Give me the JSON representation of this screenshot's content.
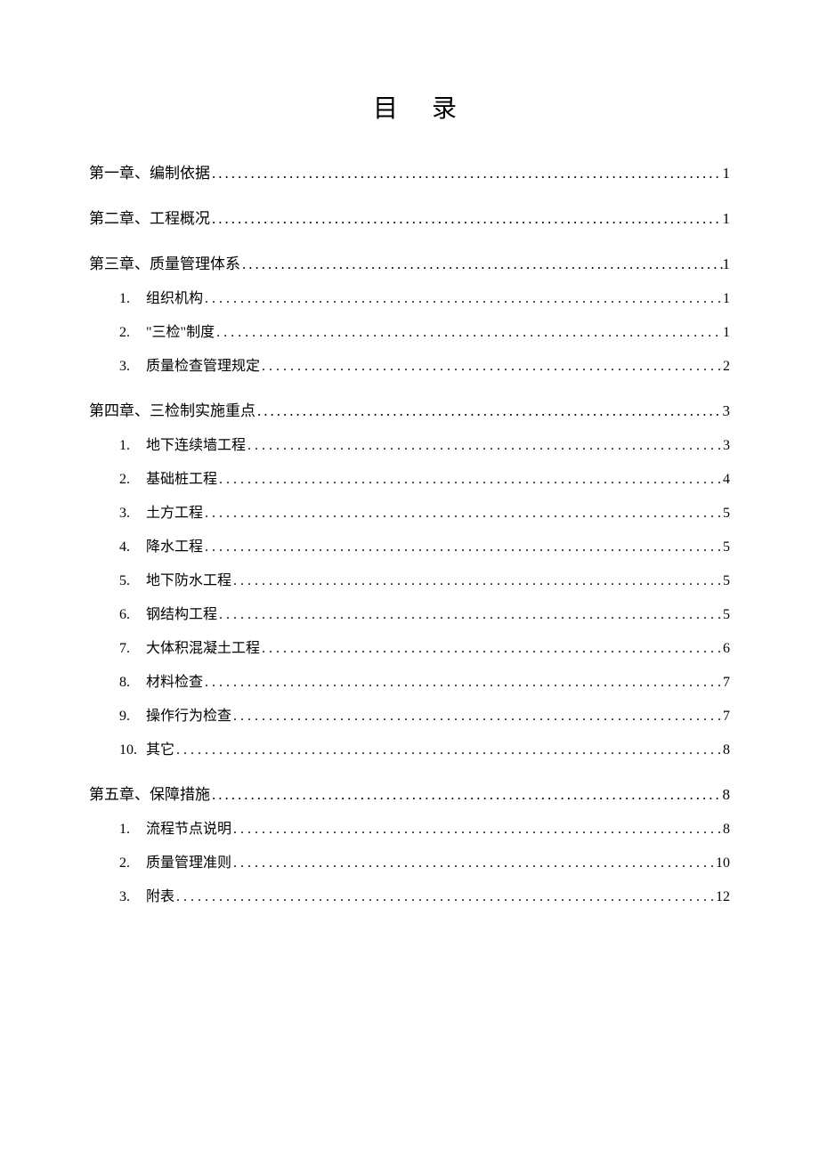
{
  "title": "目录",
  "toc": {
    "chapters": [
      {
        "label": "第一章、编制依据",
        "page": "1",
        "subs": []
      },
      {
        "label": "第二章、工程概况",
        "page": "1",
        "subs": []
      },
      {
        "label": "第三章、质量管理体系",
        "page": "1",
        "subs": [
          {
            "num": "1.",
            "label": "组织机构",
            "page": "1"
          },
          {
            "num": "2.",
            "label": "\"三检\"制度",
            "page": "1"
          },
          {
            "num": "3.",
            "label": "质量检查管理规定",
            "page": "2"
          }
        ]
      },
      {
        "label": "第四章、三检制实施重点",
        "page": "3",
        "subs": [
          {
            "num": "1.",
            "label": "地下连续墙工程",
            "page": "3"
          },
          {
            "num": "2.",
            "label": "基础桩工程",
            "page": "4"
          },
          {
            "num": "3.",
            "label": "土方工程",
            "page": "5"
          },
          {
            "num": "4.",
            "label": "降水工程",
            "page": "5"
          },
          {
            "num": "5.",
            "label": "地下防水工程",
            "page": "5"
          },
          {
            "num": "6.",
            "label": "钢结构工程",
            "page": "5"
          },
          {
            "num": "7.",
            "label": "大体积混凝土工程",
            "page": "6"
          },
          {
            "num": "8.",
            "label": "材料检查",
            "page": "7"
          },
          {
            "num": "9.",
            "label": "操作行为检查",
            "page": "7"
          },
          {
            "num": "10.",
            "label": "其它",
            "page": "8"
          }
        ]
      },
      {
        "label": "第五章、保障措施",
        "page": "8",
        "subs": [
          {
            "num": "1.",
            "label": "流程节点说明",
            "page": "8"
          },
          {
            "num": "2.",
            "label": "质量管理准则",
            "page": "10"
          },
          {
            "num": "3.",
            "label": "附表",
            "page": "12"
          }
        ]
      }
    ]
  }
}
